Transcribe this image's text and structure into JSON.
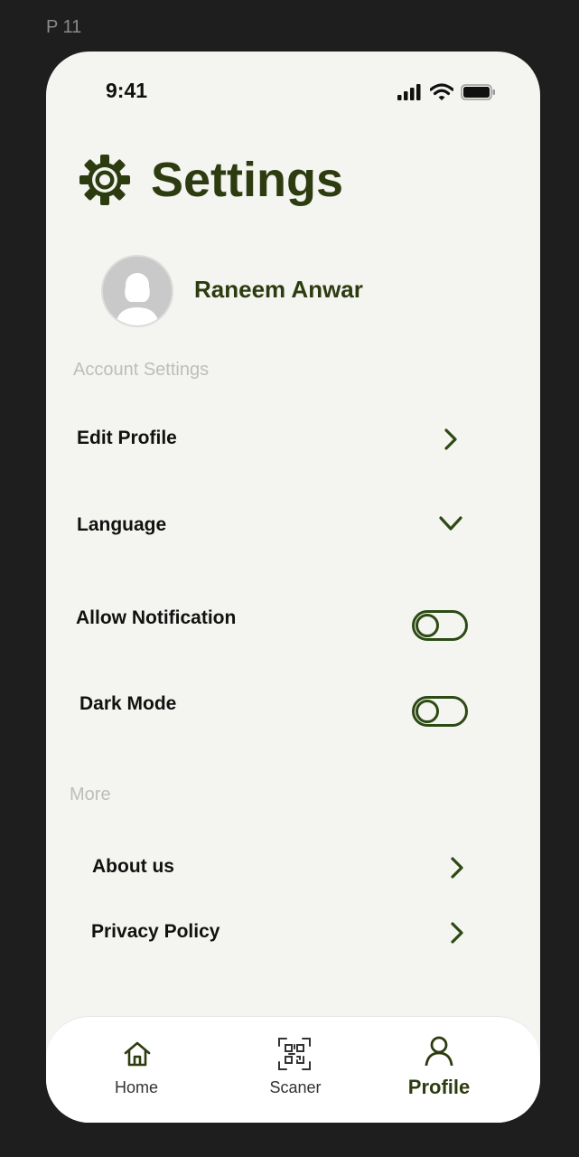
{
  "frame": {
    "label": "P 11"
  },
  "status_bar": {
    "time": "9:41",
    "icons": [
      "signal-icon",
      "wifi-icon",
      "battery-icon"
    ]
  },
  "header": {
    "title": "Settings",
    "icon": "gear-icon"
  },
  "user": {
    "name": "Raneem Anwar",
    "avatar": "avatar-placeholder"
  },
  "account_settings": {
    "header": "Account Settings",
    "items": [
      {
        "label": "Edit Profile",
        "control": "chevron-right-icon"
      },
      {
        "label": "Language",
        "control": "chevron-down-icon"
      },
      {
        "label": "Allow Notification",
        "control": "toggle",
        "on": false
      },
      {
        "label": "Dark Mode",
        "control": "toggle",
        "on": false
      }
    ]
  },
  "more": {
    "header": "More",
    "items": [
      {
        "label": "About us",
        "control": "chevron-right-icon"
      },
      {
        "label": "Privacy Policy",
        "control": "chevron-right-icon"
      }
    ]
  },
  "bottom_nav": {
    "items": [
      {
        "label": "Home",
        "icon": "home-icon",
        "active": false
      },
      {
        "label": "Scaner",
        "icon": "qr-scan-icon",
        "active": false
      },
      {
        "label": "Profile",
        "icon": "user-icon",
        "active": true
      }
    ]
  },
  "colors": {
    "accent": "#2d3c10",
    "background": "#f4f4f0",
    "outer_background": "#1e1e1e",
    "section_header": "#bdbdbd"
  }
}
